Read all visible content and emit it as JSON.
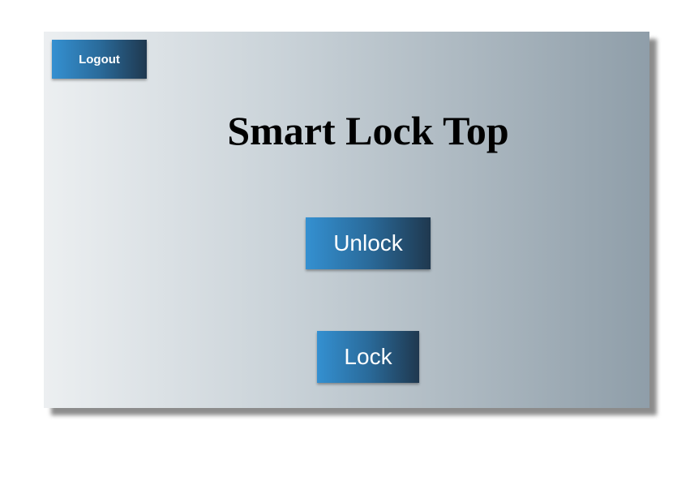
{
  "header": {
    "logout_label": "Logout"
  },
  "main": {
    "title": "Smart Lock Top",
    "unlock_label": "Unlock",
    "lock_label": "Lock"
  },
  "colors": {
    "button_gradient_start": "#3490d1",
    "button_gradient_end": "#1f384f",
    "panel_gradient_start": "#eceff1",
    "panel_gradient_end": "#8f9ea9"
  }
}
